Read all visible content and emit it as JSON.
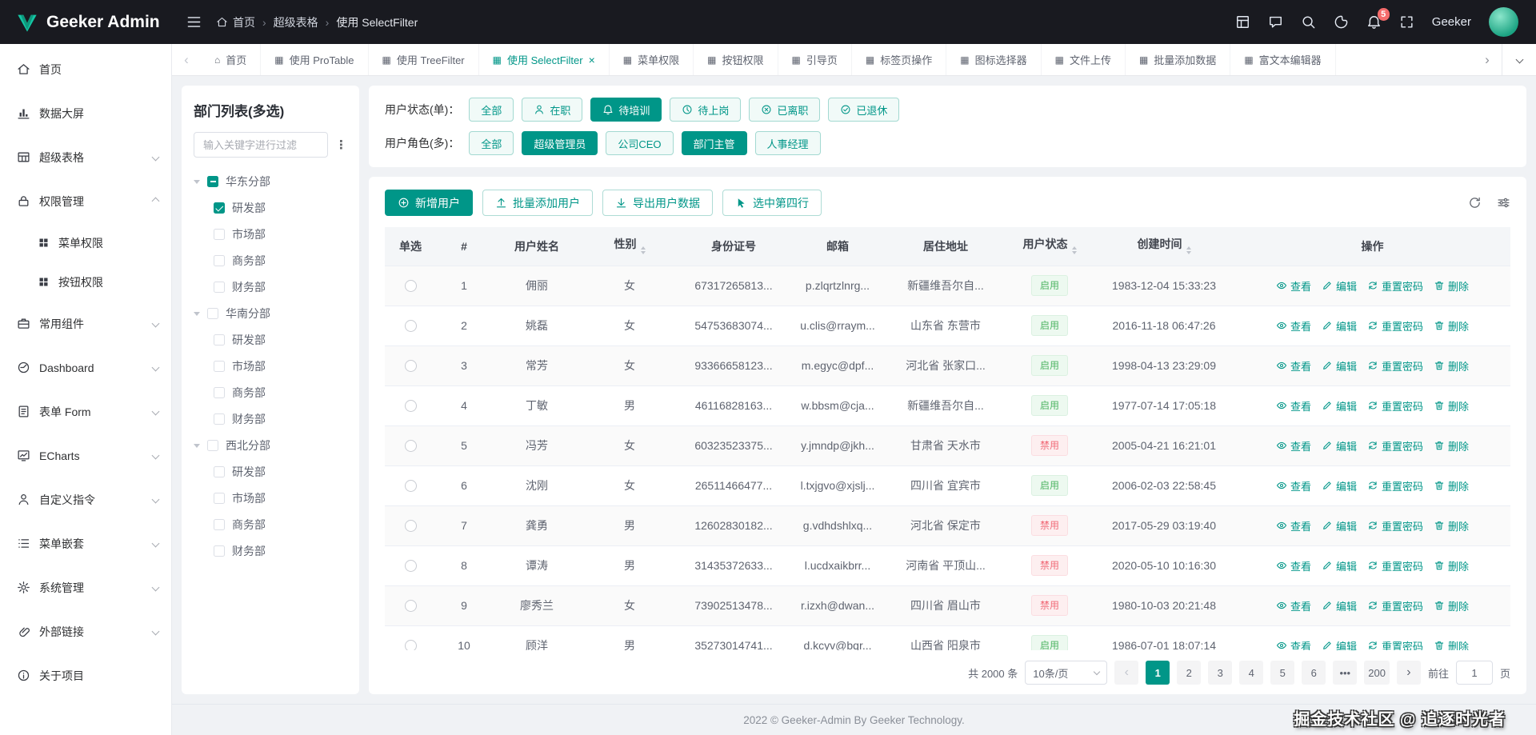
{
  "colors": {
    "primary": "#009688",
    "header_bg": "#191a20",
    "success": "#4fb563",
    "danger": "#f16c79"
  },
  "header": {
    "logo_text": "Geeker Admin",
    "breadcrumb": [
      "首页",
      "超级表格",
      "使用 SelectFilter"
    ],
    "bell_badge": "5",
    "username": "Geeker"
  },
  "tabbar": {
    "tabs": [
      {
        "label": "首页",
        "icon": "⌂",
        "state": "off",
        "closable": "no"
      },
      {
        "label": "使用 ProTable",
        "icon": "▦",
        "state": "off",
        "closable": "no"
      },
      {
        "label": "使用 TreeFilter",
        "icon": "▦",
        "state": "off",
        "closable": "no"
      },
      {
        "label": "使用 SelectFilter",
        "icon": "▦",
        "state": "on",
        "closable": "yes"
      },
      {
        "label": "菜单权限",
        "icon": "▦",
        "state": "off",
        "closable": "no"
      },
      {
        "label": "按钮权限",
        "icon": "▦",
        "state": "off",
        "closable": "no"
      },
      {
        "label": "引导页",
        "icon": "▦",
        "state": "off",
        "closable": "no"
      },
      {
        "label": "标签页操作",
        "icon": "▦",
        "state": "off",
        "closable": "no"
      },
      {
        "label": "图标选择器",
        "icon": "▦",
        "state": "off",
        "closable": "no"
      },
      {
        "label": "文件上传",
        "icon": "▦",
        "state": "off",
        "closable": "no"
      },
      {
        "label": "批量添加数据",
        "icon": "▦",
        "state": "off",
        "closable": "no"
      },
      {
        "label": "富文本编辑器",
        "icon": "▦",
        "state": "off",
        "closable": "no"
      }
    ]
  },
  "sidebar": {
    "items": {
      "home": "首页",
      "screen": "数据大屏",
      "protable": "超级表格",
      "auth": "权限管理",
      "auth_menu": "菜单权限",
      "auth_button": "按钮权限",
      "components": "常用组件",
      "dashboard": "Dashboard",
      "form": "表单 Form",
      "echarts": "ECharts",
      "directives": "自定义指令",
      "nested": "菜单嵌套",
      "system": "系统管理",
      "links": "外部链接",
      "about": "关于项目"
    }
  },
  "dept": {
    "title": "部门列表(多选)",
    "search_placeholder": "输入关键字进行过滤",
    "tree": [
      {
        "label": "华东分部",
        "checkbox": "half",
        "children": [
          {
            "label": "研发部",
            "checkbox": "on"
          },
          {
            "label": "市场部",
            "checkbox": "off"
          },
          {
            "label": "商务部",
            "checkbox": "off"
          },
          {
            "label": "财务部",
            "checkbox": "off"
          }
        ]
      },
      {
        "label": "华南分部",
        "checkbox": "off",
        "children": [
          {
            "label": "研发部",
            "checkbox": "off"
          },
          {
            "label": "市场部",
            "checkbox": "off"
          },
          {
            "label": "商务部",
            "checkbox": "off"
          },
          {
            "label": "财务部",
            "checkbox": "off"
          }
        ]
      },
      {
        "label": "西北分部",
        "checkbox": "off",
        "children": [
          {
            "label": "研发部",
            "checkbox": "off"
          },
          {
            "label": "市场部",
            "checkbox": "off"
          },
          {
            "label": "商务部",
            "checkbox": "off"
          },
          {
            "label": "财务部",
            "checkbox": "off"
          }
        ]
      }
    ]
  },
  "filters": {
    "status_label": "用户状态(单)：",
    "status": [
      {
        "label": "全部",
        "state": "off"
      },
      {
        "label": "在职",
        "state": "off"
      },
      {
        "label": "待培训",
        "state": "on"
      },
      {
        "label": "待上岗",
        "state": "off"
      },
      {
        "label": "已离职",
        "state": "off"
      },
      {
        "label": "已退休",
        "state": "off"
      }
    ],
    "role_label": "用户角色(多)：",
    "roles": [
      {
        "label": "全部",
        "state": "off"
      },
      {
        "label": "超级管理员",
        "state": "on"
      },
      {
        "label": "公司CEO",
        "state": "off"
      },
      {
        "label": "部门主管",
        "state": "on"
      },
      {
        "label": "人事经理",
        "state": "off"
      }
    ]
  },
  "toolbar": {
    "add": "新增用户",
    "batch_add": "批量添加用户",
    "export": "导出用户数据",
    "select_fourth": "选中第四行"
  },
  "table": {
    "columns": [
      "单选",
      "#",
      "用户姓名",
      "性别",
      "身份证号",
      "邮箱",
      "居住地址",
      "用户状态",
      "创建时间",
      "操作"
    ],
    "actions": {
      "view": "查看",
      "edit": "编辑",
      "reset": "重置密码",
      "del": "删除"
    },
    "rows": [
      {
        "index": "1",
        "name": "佣丽",
        "gender": "女",
        "id_card": "67317265813...",
        "email": "p.zlqrtzlnrg...",
        "address": "新疆维吾尔自...",
        "status": "启用",
        "status_type": "on",
        "created": "1983-12-04 15:33:23"
      },
      {
        "index": "2",
        "name": "姚磊",
        "gender": "女",
        "id_card": "54753683074...",
        "email": "u.clis@rraym...",
        "address": "山东省 东营市",
        "status": "启用",
        "status_type": "on",
        "created": "2016-11-18 06:47:26"
      },
      {
        "index": "3",
        "name": "常芳",
        "gender": "女",
        "id_card": "93366658123...",
        "email": "m.egyc@dpf...",
        "address": "河北省 张家口...",
        "status": "启用",
        "status_type": "on",
        "created": "1998-04-13 23:29:09"
      },
      {
        "index": "4",
        "name": "丁敏",
        "gender": "男",
        "id_card": "46116828163...",
        "email": "w.bbsm@cja...",
        "address": "新疆维吾尔自...",
        "status": "启用",
        "status_type": "on",
        "created": "1977-07-14 17:05:18"
      },
      {
        "index": "5",
        "name": "冯芳",
        "gender": "女",
        "id_card": "60323523375...",
        "email": "y.jmndp@jkh...",
        "address": "甘肃省 天水市",
        "status": "禁用",
        "status_type": "off",
        "created": "2005-04-21 16:21:01"
      },
      {
        "index": "6",
        "name": "沈刚",
        "gender": "女",
        "id_card": "26511466477...",
        "email": "l.txjgvo@xjslj...",
        "address": "四川省 宜宾市",
        "status": "启用",
        "status_type": "on",
        "created": "2006-02-03 22:58:45"
      },
      {
        "index": "7",
        "name": "龚勇",
        "gender": "男",
        "id_card": "12602830182...",
        "email": "g.vdhdshlxq...",
        "address": "河北省 保定市",
        "status": "禁用",
        "status_type": "off",
        "created": "2017-05-29 03:19:40"
      },
      {
        "index": "8",
        "name": "谭涛",
        "gender": "男",
        "id_card": "31435372633...",
        "email": "l.ucdxaikbrr...",
        "address": "河南省 平顶山...",
        "status": "禁用",
        "status_type": "off",
        "created": "2020-05-10 10:16:30"
      },
      {
        "index": "9",
        "name": "廖秀兰",
        "gender": "女",
        "id_card": "73902513478...",
        "email": "r.izxh@dwan...",
        "address": "四川省 眉山市",
        "status": "禁用",
        "status_type": "off",
        "created": "1980-10-03 20:21:48"
      },
      {
        "index": "10",
        "name": "顾洋",
        "gender": "男",
        "id_card": "35273014741...",
        "email": "d.kcyv@bqr...",
        "address": "山西省 阳泉市",
        "status": "启用",
        "status_type": "on",
        "created": "1986-07-01 18:07:14"
      }
    ]
  },
  "pagination": {
    "total": "共 2000 条",
    "page_size": "10条/页",
    "pages": [
      {
        "label": "1",
        "state": "active"
      },
      {
        "label": "2",
        "state": "normal"
      },
      {
        "label": "3",
        "state": "normal"
      },
      {
        "label": "4",
        "state": "normal"
      },
      {
        "label": "5",
        "state": "normal"
      },
      {
        "label": "6",
        "state": "normal"
      },
      {
        "label": "•••",
        "state": "normal"
      },
      {
        "label": "200",
        "state": "normal"
      }
    ],
    "goto_label": "前往",
    "goto_value": "1",
    "unit": "页"
  },
  "footer": {
    "text": "2022 © Geeker-Admin By Geeker Technology."
  },
  "watermark": "掘金技术社区 @ 追逐时光者"
}
